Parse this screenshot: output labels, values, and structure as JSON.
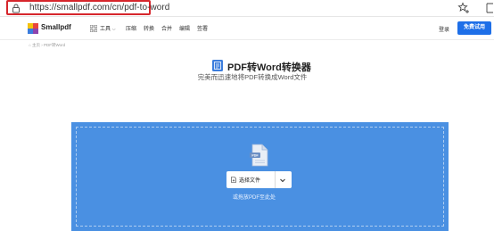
{
  "browser": {
    "url": "https://smallpdf.com/cn/pdf-to-word",
    "icons": [
      "lock-icon",
      "star-add-icon",
      "sidebar-icon"
    ]
  },
  "header": {
    "logo_text": "Smallpdf",
    "tools_label": "工具",
    "nav": [
      "压缩",
      "转换",
      "合并",
      "编辑",
      "签署"
    ],
    "login_label": "登录",
    "trial_label": "免费试用",
    "accent_color": "#1e6fe8"
  },
  "breadcrumb": {
    "home": "主页",
    "separator": "›",
    "current": "PDF转Word"
  },
  "main": {
    "title": "PDF转Word转换器",
    "subtitle": "完美而迅速地将PDF转换成Word文件",
    "dropzone_color": "#4a90e2",
    "select_button_label": "选择文件",
    "drop_hint": "或拖放PDF至此处"
  }
}
